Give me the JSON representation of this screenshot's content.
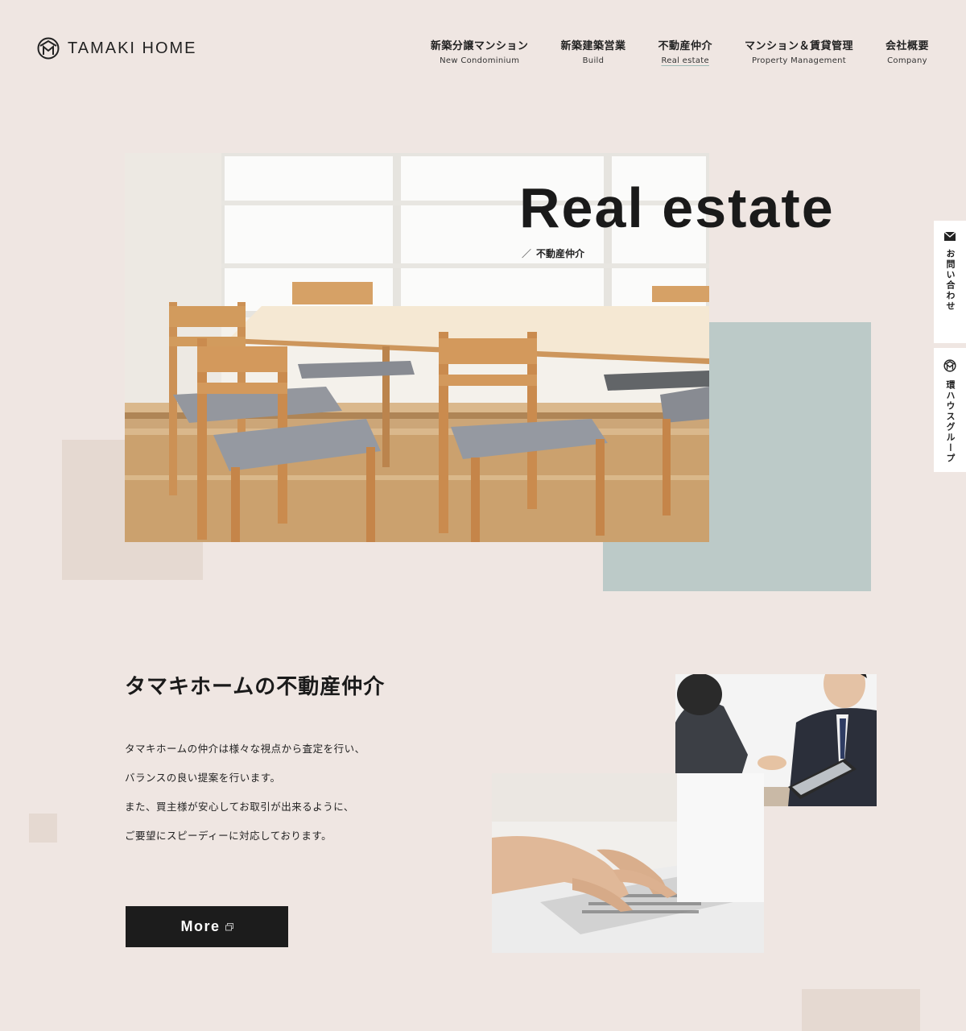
{
  "header": {
    "logo_text": "TAMAKI HOME",
    "nav": [
      {
        "jp": "新築分譲マンション",
        "en": "New Condominium"
      },
      {
        "jp": "新築建築営業",
        "en": "Build"
      },
      {
        "jp": "不動産仲介",
        "en": "Real estate"
      },
      {
        "jp": "マンション＆賃貸管理",
        "en": "Property Management"
      },
      {
        "jp": "会社概要",
        "en": "Company"
      }
    ]
  },
  "hero": {
    "title": "Real estate",
    "subtitle": "不動産仲介",
    "slash": "／"
  },
  "side": {
    "contact": "お問い合わせ",
    "group": "環ハウスグループ"
  },
  "section": {
    "title": "タマキホームの不動産仲介",
    "lines": [
      "タマキホームの仲介は様々な視点から査定を行い、",
      "バランスの良い提案を行います。",
      "また、買主様が安心してお取引が出来るように、",
      "ご要望にスピーディーに対応しております。"
    ],
    "more_label": "More"
  },
  "colors": {
    "background": "#efe6e2",
    "accent_teal": "#bccac8",
    "accent_beige": "#e5d9d1",
    "button": "#1c1c1c"
  }
}
